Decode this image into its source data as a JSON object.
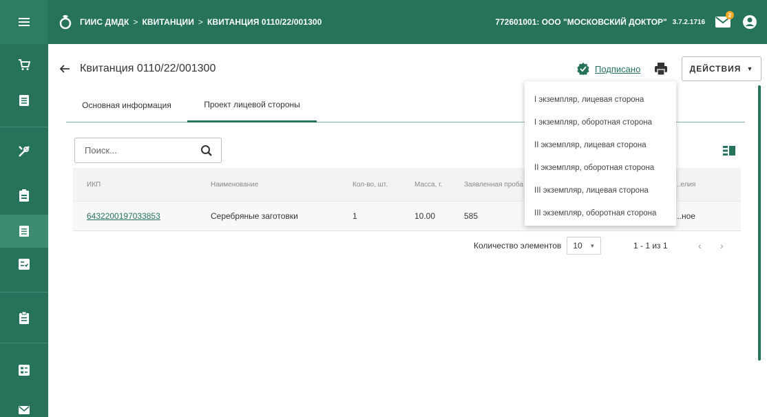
{
  "topbar": {
    "breadcrumb": [
      "ГИИС ДМДК",
      "КВИТАНЦИИ",
      "КВИТАНЦИЯ 0110/22/001300"
    ],
    "separator": ">",
    "org": "772601001: ООО \"МОСКОВСКИЙ ДОКТОР\"",
    "version": "3.7.2.1716",
    "mail_badge": "2",
    "bg_color": "#27725a"
  },
  "sidebar": {
    "items": [
      "cart-icon",
      "document-icon",
      "tools-icon",
      "badge-icon",
      "document-icon",
      "checklist-icon",
      "clipboard-icon",
      "form-icon",
      "mail-icon"
    ]
  },
  "header": {
    "title": "Квитанция 0110/22/001300",
    "status": "Подписано",
    "actions_label": "ДЕЙСТВИЯ"
  },
  "tabs": [
    {
      "label": "Основная информация"
    },
    {
      "label": "Проект лицевой стороны"
    }
  ],
  "search": {
    "placeholder": "Поиск..."
  },
  "table": {
    "columns": [
      "ИКП",
      "Наименование",
      "Кол-во, шт.",
      "Масса, г.",
      "Заявленная проба",
      "...елия"
    ],
    "rows": [
      {
        "ikp": "6432200197033853",
        "name": "Серебряные заготовки",
        "qty": "1",
        "mass": "10.00",
        "probe": "585",
        "last": "...ное"
      }
    ]
  },
  "pager": {
    "label": "Количество элементов",
    "page_size": "10",
    "range": "1 - 1 из 1",
    "prev": "‹",
    "next": "›"
  },
  "dropdown": {
    "items": [
      "I экземпляр, лицевая сторона",
      "I экземпляр, оборотная сторона",
      "II экземпляр, лицевая сторона",
      "II экземпляр, оборотная сторона",
      "III экземпляр, лицевая сторона",
      "III экземпляр, оборотная сторона"
    ]
  }
}
